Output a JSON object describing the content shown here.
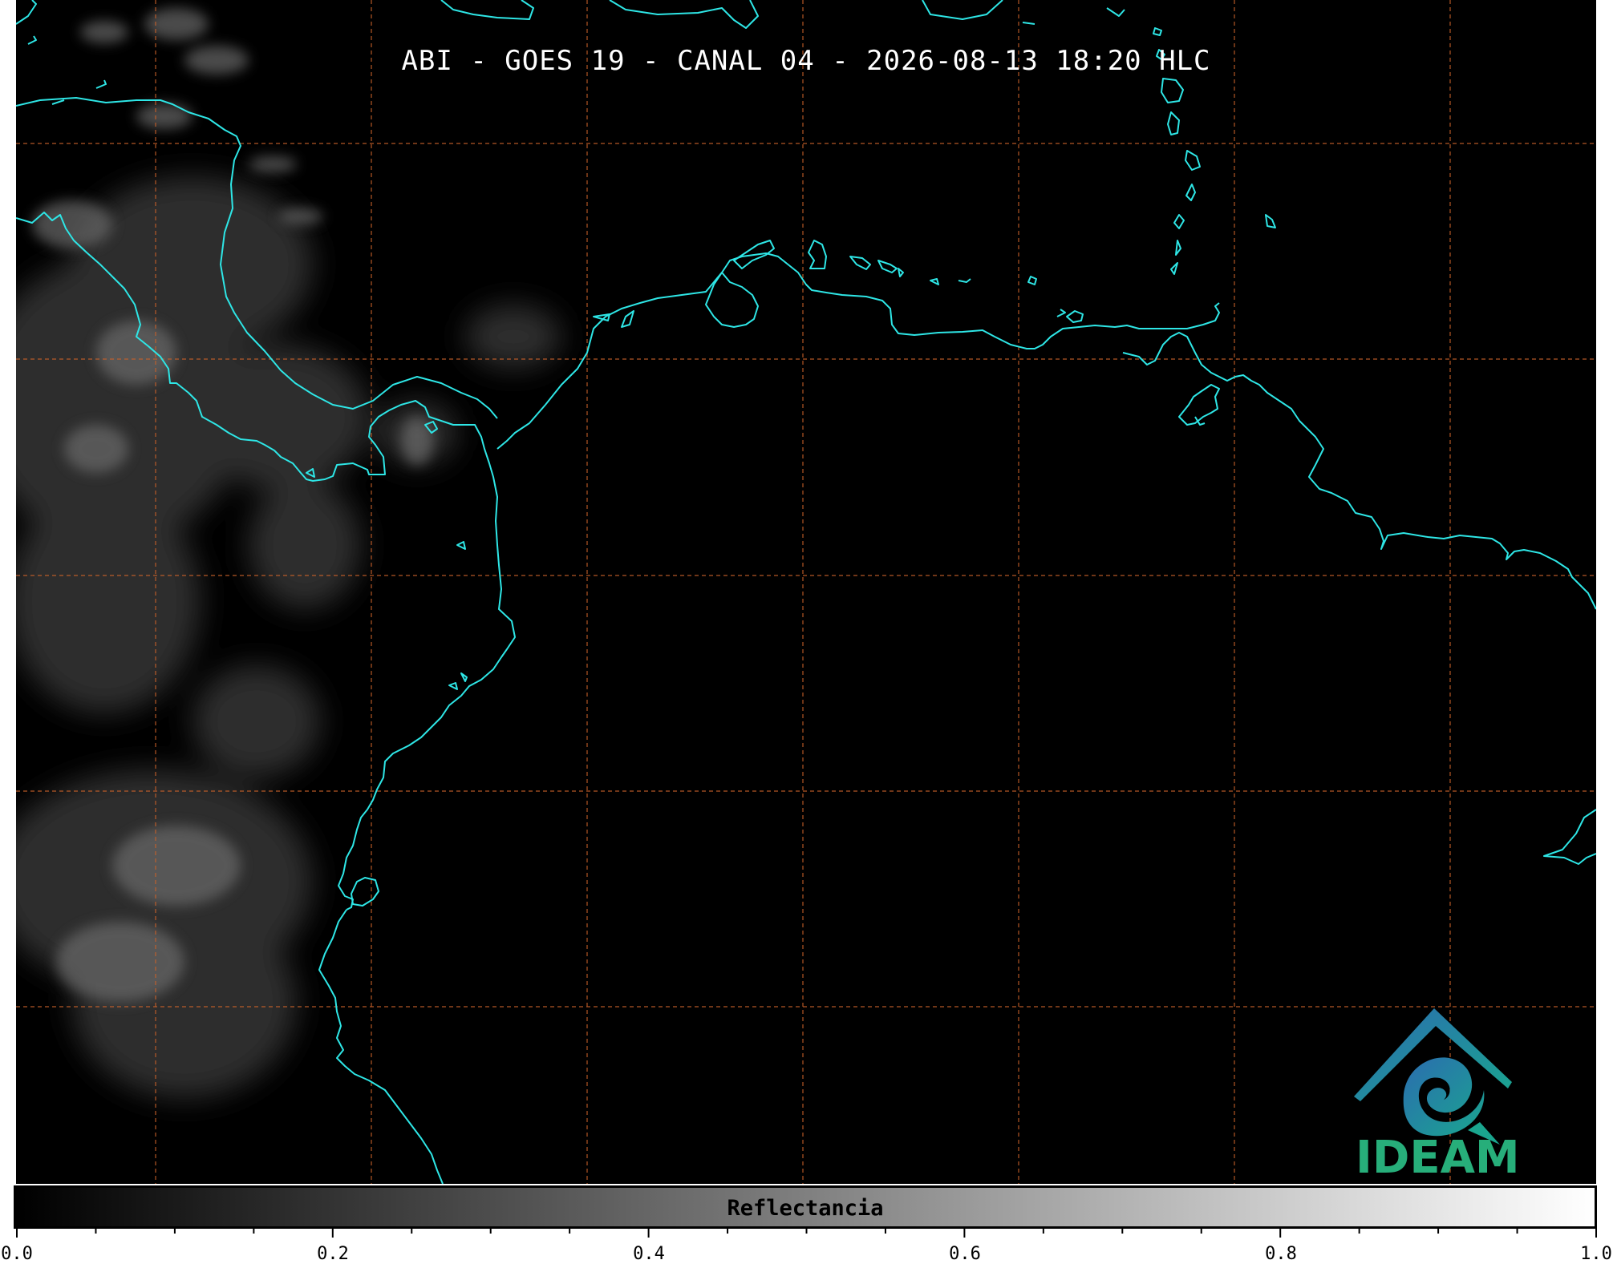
{
  "title": "ABI - GOES 19 - CANAL 04 - 2026-08-13 18:20 HLC",
  "colorbar": {
    "label": "Reflectancia",
    "colormap": [
      "#000000",
      "#ffffff"
    ],
    "range": [
      0.0,
      1.0
    ],
    "major_ticks": [
      "0.0",
      "0.2",
      "0.4",
      "0.6",
      "0.8",
      "1.0"
    ],
    "minor_step": 0.05
  },
  "map": {
    "background": "#000000",
    "coastline_color": "#2ee6e6",
    "gridline_color": "#c8602a",
    "gridline_style": "dashed"
  },
  "logo": {
    "text": "IDEAM",
    "colors": [
      "#2b6cb0",
      "#1aa68f",
      "#27ae7a"
    ]
  }
}
